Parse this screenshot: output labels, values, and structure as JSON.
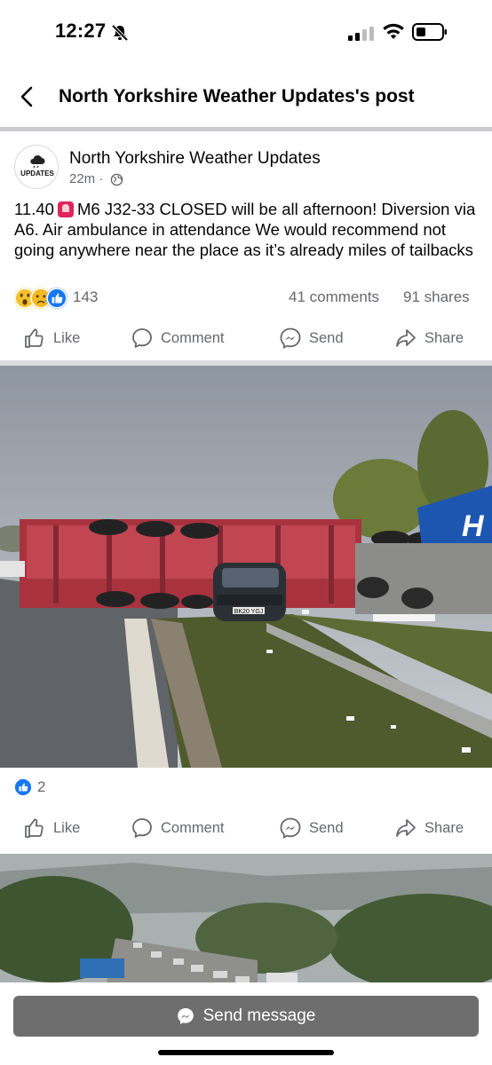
{
  "status_bar": {
    "time": "12:27"
  },
  "header": {
    "title": "North Yorkshire Weather Updates's post"
  },
  "post": {
    "author": "North Yorkshire Weather Updates",
    "avatar_text": "UPDATES",
    "time": "22m ·",
    "text_before_icon": "11.40",
    "text_after_icon": "M6 J32-33 CLOSED will be all afternoon! Diversion via A6. Air ambulance in attendance We would recommend not going anywhere near the place as it’s already miles of tailbacks",
    "reaction_count": "143",
    "comments": "41 comments",
    "shares": "91 shares"
  },
  "actions": {
    "like": "Like",
    "comment": "Comment",
    "send": "Send",
    "share": "Share"
  },
  "photo1": {
    "car_plate": "BK20 YGJ",
    "truck_text": "H"
  },
  "photo1_reactions": {
    "count": "2"
  },
  "bottom": {
    "send_message": "Send message"
  },
  "icons": [
    "back-icon",
    "bell-slash-icon",
    "signal-icon",
    "wifi-icon",
    "battery-icon",
    "globe-icon",
    "like-icon",
    "comment-icon",
    "messenger-icon",
    "share-icon"
  ],
  "colors": {
    "facebook_blue": "#1877f2",
    "secondary_text": "#65676b",
    "send_button": "#6e6e6e"
  }
}
